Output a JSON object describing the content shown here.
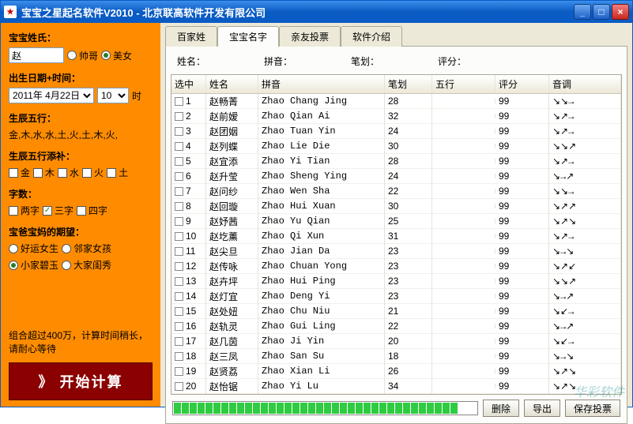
{
  "window": {
    "title": "宝宝之星起名软件V2010 - 北京联高软件开发有限公司",
    "icon_glyph": "★"
  },
  "sidebar": {
    "surname_label": "宝宝姓氏：",
    "surname_value": "赵",
    "gender": {
      "boy": "帅哥",
      "girl": "美女",
      "selected": "girl"
    },
    "birth_label": "出生日期+时间：",
    "birth_date": "2011年 4月22日",
    "birth_hour": "10",
    "hour_suffix": "时",
    "wuxing_label": "生辰五行：",
    "wuxing_value": "金,木,水,水,土,火,土,木,火,",
    "tianbu_label": "生辰五行添补：",
    "tianbu": {
      "jin": "金",
      "mu": "木",
      "shui": "水",
      "huo": "火",
      "tu": "土"
    },
    "zishu_label": "字数：",
    "zishu": {
      "two": "两字",
      "three": "三字",
      "four": "四字",
      "selected": "three"
    },
    "qiwang_label": "宝爸宝妈的期望：",
    "qiwang": {
      "opt1": "好运女生",
      "opt2": "邻家女孩",
      "opt3": "小家碧玉",
      "opt4": "大家闺秀",
      "selected": "opt3"
    },
    "hint": "组合超过400万，计算时间稍长，请耐心等待",
    "start_btn": "》 开始计算"
  },
  "tabs": {
    "items": [
      "百家姓",
      "宝宝名字",
      "亲友投票",
      "软件介绍"
    ],
    "active": 1
  },
  "filter": {
    "name": "姓名：",
    "pinyin": "拼音：",
    "bihua": "笔划：",
    "score": "评分："
  },
  "list": {
    "headers": {
      "sel": "选中",
      "name": "姓名",
      "pinyin": "拼音",
      "bihua": "笔划",
      "wuxing": "五行",
      "score": "评分",
      "tone": "音调"
    },
    "rows": [
      {
        "n": 1,
        "name": "赵畅菁",
        "py": "Zhao Chang Jing",
        "bh": 28,
        "score": 99,
        "tone": "↘↘→"
      },
      {
        "n": 2,
        "name": "赵前嫒",
        "py": "Zhao Qian Ai",
        "bh": 32,
        "score": 99,
        "tone": "↘↗→"
      },
      {
        "n": 3,
        "name": "赵团姻",
        "py": "Zhao Tuan Yin",
        "bh": 24,
        "score": 99,
        "tone": "↘↗→"
      },
      {
        "n": 4,
        "name": "赵列蝶",
        "py": "Zhao Lie Die",
        "bh": 30,
        "score": 99,
        "tone": "↘↘↗"
      },
      {
        "n": 5,
        "name": "赵宜添",
        "py": "Zhao Yi Tian",
        "bh": 28,
        "score": 99,
        "tone": "↘↗→"
      },
      {
        "n": 6,
        "name": "赵升莹",
        "py": "Zhao Sheng Ying",
        "bh": 24,
        "score": 99,
        "tone": "↘→↗"
      },
      {
        "n": 7,
        "name": "赵问纱",
        "py": "Zhao Wen Sha",
        "bh": 22,
        "score": 99,
        "tone": "↘↘→"
      },
      {
        "n": 8,
        "name": "赵回璇",
        "py": "Zhao Hui Xuan",
        "bh": 30,
        "score": 99,
        "tone": "↘↗↗"
      },
      {
        "n": 9,
        "name": "赵妤茜",
        "py": "Zhao Yu Qian",
        "bh": 25,
        "score": 99,
        "tone": "↘↗↘"
      },
      {
        "n": 10,
        "name": "赵圪薰",
        "py": "Zhao Qi Xun",
        "bh": 31,
        "score": 99,
        "tone": "↘↗→"
      },
      {
        "n": 11,
        "name": "赵尖旦",
        "py": "Zhao Jian Da",
        "bh": 23,
        "score": 99,
        "tone": "↘→↘"
      },
      {
        "n": 12,
        "name": "赵传咏",
        "py": "Zhao Chuan Yong",
        "bh": 23,
        "score": 99,
        "tone": "↘↗↙"
      },
      {
        "n": 13,
        "name": "赵卉坪",
        "py": "Zhao Hui Ping",
        "bh": 23,
        "score": 99,
        "tone": "↘↘↗"
      },
      {
        "n": 14,
        "name": "赵灯宜",
        "py": "Zhao Deng Yi",
        "bh": 23,
        "score": 99,
        "tone": "↘→↗"
      },
      {
        "n": 15,
        "name": "赵处妞",
        "py": "Zhao Chu Niu",
        "bh": 21,
        "score": 99,
        "tone": "↘↙→"
      },
      {
        "n": 16,
        "name": "赵轨灵",
        "py": "Zhao Gui Ling",
        "bh": 22,
        "score": 99,
        "tone": "↘→↗"
      },
      {
        "n": 17,
        "name": "赵几茵",
        "py": "Zhao Ji Yin",
        "bh": 20,
        "score": 99,
        "tone": "↘↙→"
      },
      {
        "n": 18,
        "name": "赵三凤",
        "py": "Zhao San Su",
        "bh": 18,
        "score": 99,
        "tone": "↘→↘"
      },
      {
        "n": 19,
        "name": "赵贤荔",
        "py": "Zhao Xian Li",
        "bh": 26,
        "score": 99,
        "tone": "↘↗↘"
      },
      {
        "n": 20,
        "name": "赵怡锯",
        "py": "Zhao Yi Lu",
        "bh": 34,
        "score": 99,
        "tone": "↘↗↘"
      }
    ]
  },
  "bottom": {
    "delete": "删除",
    "export": "导出",
    "save_vote": "保存投票"
  },
  "watermark": "华彩软件"
}
